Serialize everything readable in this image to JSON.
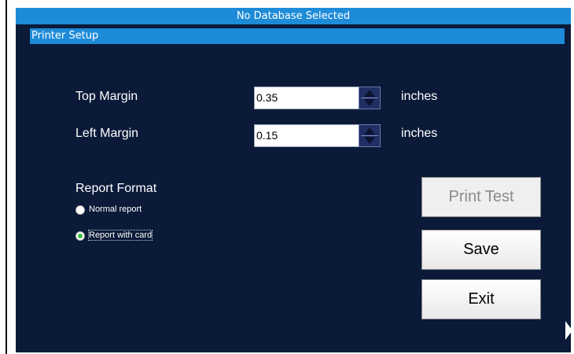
{
  "window": {
    "title": "No Database Selected"
  },
  "section": {
    "title": "Printer Setup"
  },
  "fields": {
    "top_margin": {
      "label": "Top Margin",
      "value": "0.35",
      "unit": "inches"
    },
    "left_margin": {
      "label": "Left Margin",
      "value": "0.15",
      "unit": "inches"
    }
  },
  "report_format": {
    "heading": "Report Format",
    "options": [
      {
        "label": "Normal report",
        "selected": false
      },
      {
        "label": "Report with card",
        "selected": true
      }
    ]
  },
  "buttons": {
    "print_test": "Print Test",
    "save": "Save",
    "exit": "Exit"
  },
  "colors": {
    "panel": "#0a1a38",
    "bar": "#1e8bd8",
    "radio_selected": "#3bbf3b"
  }
}
